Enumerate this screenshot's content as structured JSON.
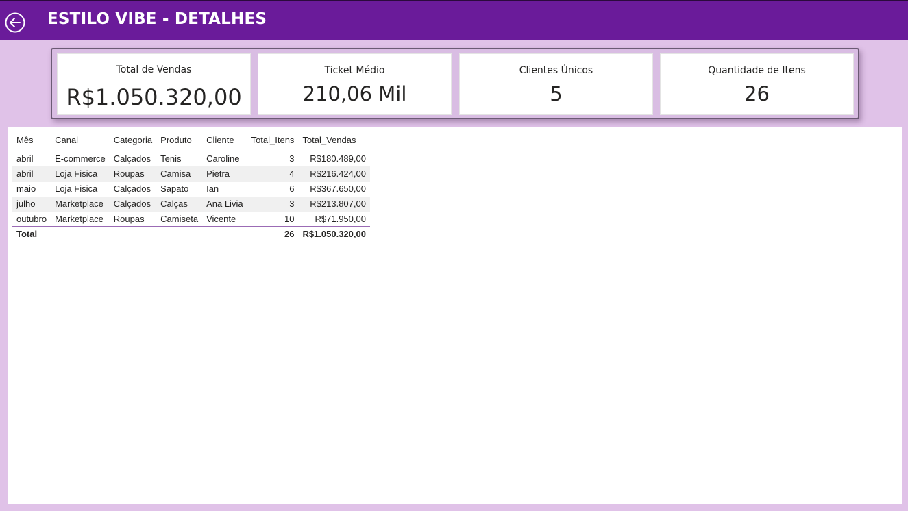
{
  "header": {
    "title": "ESTILO VIBE - DETALHES",
    "back_icon": "arrow-left-circle-icon",
    "bg_color": "#6a1b9a"
  },
  "kpis": [
    {
      "label": "Total de Vendas",
      "value": "R$1.050.320,00"
    },
    {
      "label": "Ticket Médio",
      "value": "210,06 Mil"
    },
    {
      "label": "Clientes Únicos",
      "value": "5"
    },
    {
      "label": "Quantidade de Itens",
      "value": "26"
    }
  ],
  "table": {
    "columns": [
      "Mês",
      "Canal",
      "Categoria",
      "Produto",
      "Cliente",
      "Total_Itens",
      "Total_Vendas"
    ],
    "rows": [
      [
        "abril",
        "E-commerce",
        "Calçados",
        "Tenis",
        "Caroline",
        "3",
        "R$180.489,00"
      ],
      [
        "abril",
        "Loja Fisica",
        "Roupas",
        "Camisa",
        "Pietra",
        "4",
        "R$216.424,00"
      ],
      [
        "maio",
        "Loja Fisica",
        "Calçados",
        "Sapato",
        "Ian",
        "6",
        "R$367.650,00"
      ],
      [
        "julho",
        "Marketplace",
        "Calçados",
        "Calças",
        "Ana Livia",
        "3",
        "R$213.807,00"
      ],
      [
        "outubro",
        "Marketplace",
        "Roupas",
        "Camiseta",
        "Vicente",
        "10",
        "R$71.950,00"
      ]
    ],
    "total": {
      "label": "Total",
      "total_itens": "26",
      "total_vendas": "R$1.050.320,00"
    }
  },
  "colors": {
    "page_bg": "#e0c2e8",
    "accent": "#6a1b9a",
    "row_alt": "#f0f0f0"
  }
}
